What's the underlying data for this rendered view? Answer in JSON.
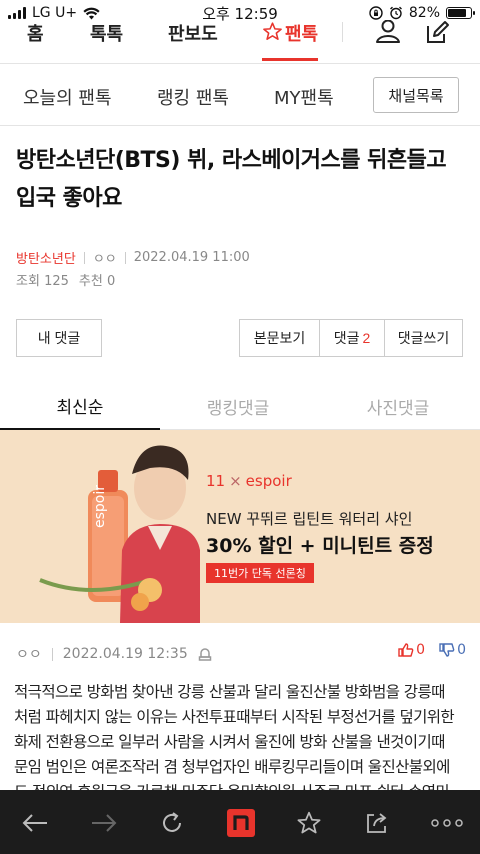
{
  "status": {
    "carrier": "LG U+",
    "time": "오후 12:59",
    "battery": "82%",
    "battery_level": 0.82
  },
  "topnav": {
    "tabs": [
      {
        "label": "홈"
      },
      {
        "label": "톡톡"
      },
      {
        "label": "판보도"
      },
      {
        "label": "팬톡"
      }
    ]
  },
  "subnav": {
    "items": [
      "오늘의 팬톡",
      "랭킹 팬톡",
      "MY팬톡"
    ],
    "channel_button": "채널목록"
  },
  "article": {
    "title_line1": "방탄소년단(BTS) 뷔, 라스베이거스를 뒤흔들고",
    "title_line2": "입국 좋아요",
    "channel": "방탄소년단",
    "author": "ㅇㅇ",
    "datetime": "2022.04.19 11:00",
    "views_label": "조회",
    "views": "125",
    "recommend_label": "추천",
    "recommend": "0"
  },
  "buttons": {
    "my_comments": "내 댓글",
    "view_article": "본문보기",
    "comments_label": "댓글",
    "comments_count": "2",
    "write_comment": "댓글쓰기"
  },
  "comment_tabs": [
    "최신순",
    "랭킹댓글",
    "사진댓글"
  ],
  "ad": {
    "brand_left": "11",
    "brand_sep": "×",
    "brand_right": "espoir",
    "product_label": "espoir",
    "line1": "NEW 꾸뛰르 립틴트 워터리 샤인",
    "line2": "30% 할인 + 미니틴트 증정",
    "badge": "11번가 단독 선론칭"
  },
  "comment": {
    "author": "ㅇㅇ",
    "datetime": "2022.04.19 12:35",
    "up": "0",
    "down": "0",
    "lines": [
      "적극적으로 방화범 찾아낸 강릉 산불과 달리 울진산불 방화범을 강릉때",
      "처럼 파헤치지 않는 이유는 사전투표때부터 시작된 부정선거를 덮기위한",
      "화제 전환용으로 일부러 사람을 시켜서 울진에 방화 산불을 낸것이기때",
      "문임 범인은 여론조작러 겸 청부업자인 배루킹무리들이며 울진산불외에",
      "도 정의연 후원금을 가로챈 민주당 윤미향의원 사주로 마포 쉼터 손영미"
    ]
  },
  "colors": {
    "accent": "#e8342c",
    "toolbar": "#1c1c1c",
    "ad_bg": "#f6e0c4",
    "down": "#4a6fb5"
  },
  "toolbar_icons": [
    "back-arrow-icon",
    "forward-arrow-icon",
    "refresh-icon",
    "nate-home-icon",
    "bookmark-star-icon",
    "share-icon",
    "more-icon"
  ]
}
